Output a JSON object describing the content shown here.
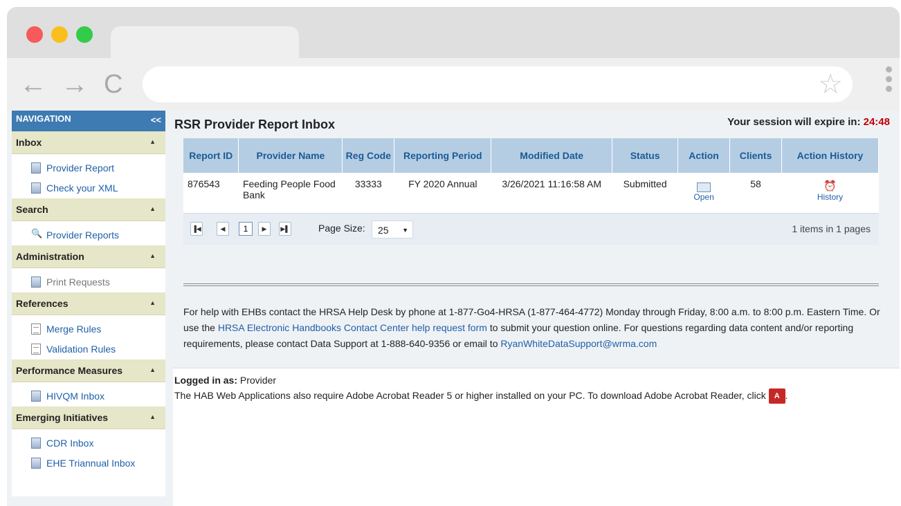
{
  "colors": {
    "close": "#f65a5b",
    "minimize": "#fbbf1d",
    "maximize": "#33cb4a",
    "accent": "#3d7bb2",
    "session_time": "#c00000"
  },
  "browser": {
    "back_icon": "←",
    "forward_icon": "→",
    "reload_icon": "C",
    "star_icon": "☆"
  },
  "nav": {
    "header": "NAVIGATION",
    "collapse": "<<",
    "sections": [
      {
        "title": "Inbox",
        "items": [
          "Provider Report",
          "Check your XML"
        ]
      },
      {
        "title": "Search",
        "items": [
          "Provider Reports"
        ]
      },
      {
        "title": "Administration",
        "items": [
          "Print Requests"
        ]
      },
      {
        "title": "References",
        "items": [
          "Merge Rules",
          "Validation Rules"
        ]
      },
      {
        "title": "Performance Measures",
        "items": [
          "HIVQM Inbox"
        ]
      },
      {
        "title": "Emerging Initiatives",
        "items": [
          "CDR Inbox",
          "EHE Triannual Inbox"
        ]
      }
    ]
  },
  "main": {
    "title": "RSR Provider Report Inbox",
    "session_label": "Your session will expire in:",
    "session_time": "24:48"
  },
  "table": {
    "columns": [
      "Report ID",
      "Provider Name",
      "Reg Code",
      "Reporting Period",
      "Modified Date",
      "Status",
      "Action",
      "Clients",
      "Action History"
    ],
    "rows": [
      {
        "report_id": "876543",
        "provider_name": "Feeding People Food Bank",
        "reg_code": "33333",
        "reporting_period": "FY 2020 Annual",
        "modified_date": "3/26/2021 11:16:58 AM",
        "status": "Submitted",
        "action": "Open",
        "clients": "58",
        "history": "History"
      }
    ]
  },
  "pager": {
    "current_page": "1",
    "page_size_label": "Page Size:",
    "page_size": "25",
    "info": "1 items in 1 pages"
  },
  "help": {
    "line1": "For help with EHBs contact the HRSA Help Desk by phone at 1-877-Go4-HRSA (1-877-464-4772) Monday through Friday, 8:00 a.m. to 8:00 p.m. Eastern Time. Or use the",
    "link1": "HRSA Electronic Handbooks Contact Center help request form",
    "line2": "to submit your question online. For questions regarding data content and/or reporting requirements, please contact Data Support at 1-888-640-9356 or email to",
    "link2": "RyanWhiteDataSupport@wrma.com"
  },
  "footer": {
    "logged_label": "Logged in as:",
    "logged_user": "Provider",
    "acrobat_text": "The HAB Web Applications also require Adobe Acrobat Reader 5 or higher installed on your PC. To download Adobe Acrobat Reader, click",
    "acrobat_suffix": ".",
    "pdf_icon": "A"
  }
}
